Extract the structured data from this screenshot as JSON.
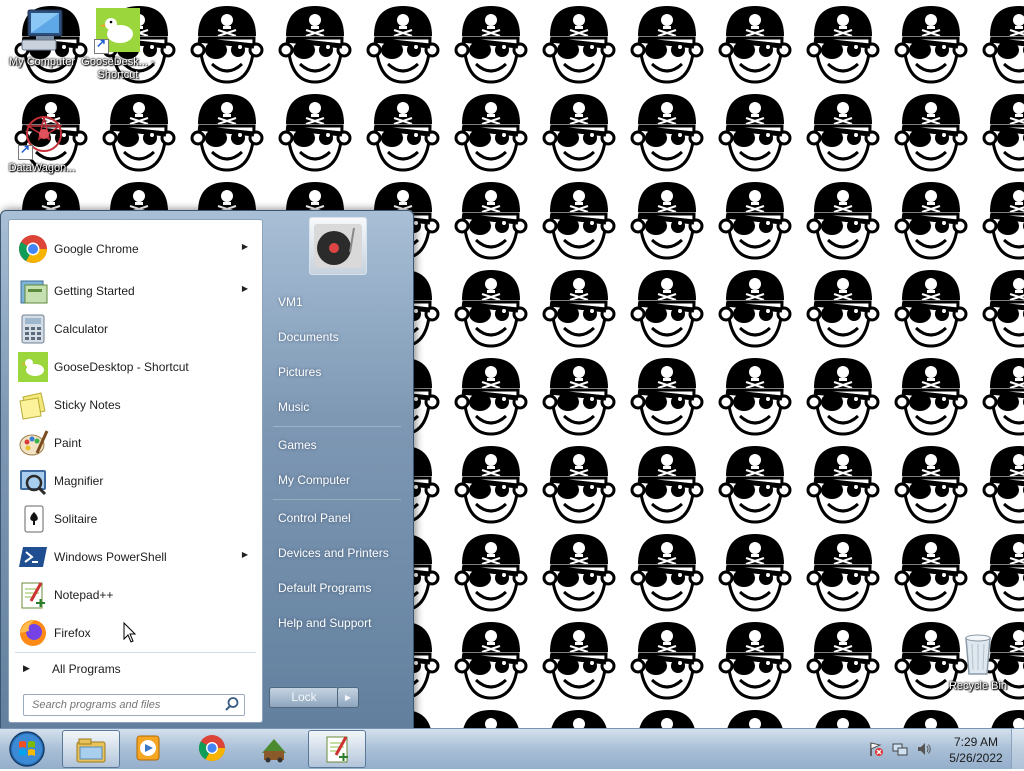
{
  "desktop": {
    "icons": [
      {
        "label": "My Computer",
        "icon": "computer-icon"
      },
      {
        "label": "GooseDesk... - Shortcut",
        "icon": "goose-icon"
      },
      {
        "label": "DataWagon...",
        "icon": "datawagon-icon"
      },
      {
        "label": "Recycle Bin",
        "icon": "recycle-bin-icon"
      }
    ]
  },
  "start_menu": {
    "programs": [
      {
        "label": "Google Chrome",
        "icon": "chrome-icon",
        "submenu": true
      },
      {
        "label": "Getting Started",
        "icon": "getting-started-icon",
        "submenu": true
      },
      {
        "label": "Calculator",
        "icon": "calculator-icon",
        "submenu": false
      },
      {
        "label": "GooseDesktop - Shortcut",
        "icon": "goose-icon",
        "submenu": false
      },
      {
        "label": "Sticky Notes",
        "icon": "sticky-notes-icon",
        "submenu": false
      },
      {
        "label": "Paint",
        "icon": "paint-icon",
        "submenu": false
      },
      {
        "label": "Magnifier",
        "icon": "magnifier-icon",
        "submenu": false
      },
      {
        "label": "Solitaire",
        "icon": "solitaire-icon",
        "submenu": false
      },
      {
        "label": "Windows PowerShell",
        "icon": "powershell-icon",
        "submenu": true
      },
      {
        "label": "Notepad++",
        "icon": "notepad-plus-plus-icon",
        "submenu": false
      },
      {
        "label": "Firefox",
        "icon": "firefox-icon",
        "submenu": false
      }
    ],
    "all_programs": "All Programs",
    "search_placeholder": "Search programs and files",
    "right_items": [
      "VM1",
      "Documents",
      "Pictures",
      "Music",
      "Games",
      "My Computer",
      "Control Panel",
      "Devices and Printers",
      "Default Programs",
      "Help and Support"
    ],
    "lock_label": "Lock"
  },
  "taskbar": {
    "pinned": [
      "explorer-icon",
      "media-player-icon",
      "chrome-icon",
      "datawagon-icon",
      "notepad-plus-plus-icon"
    ],
    "clock_time": "7:29 AM",
    "clock_date": "5/26/2022"
  },
  "colors": {
    "taskbar": "#a9bfd6",
    "start_menu_right": "#7e98b4",
    "menu_text": "#1e1e1e"
  }
}
